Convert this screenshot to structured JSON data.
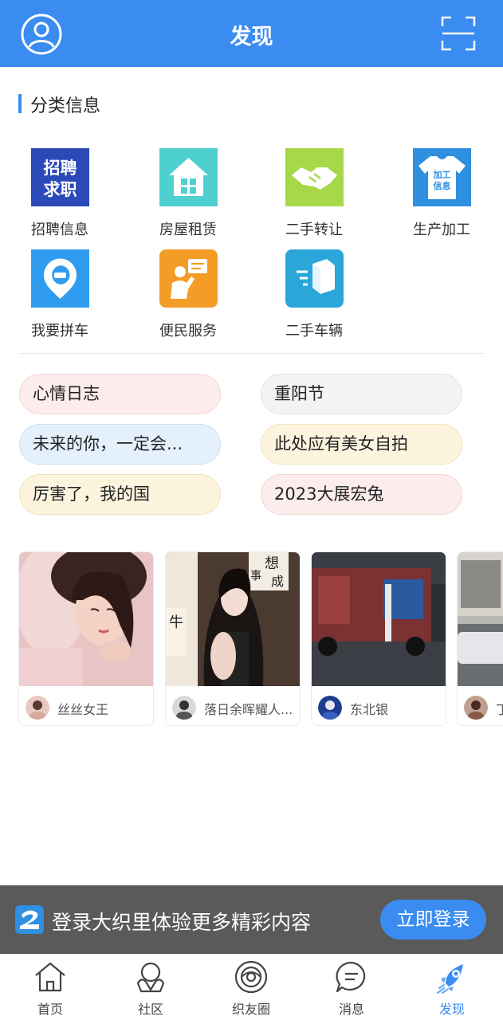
{
  "header": {
    "title": "发现",
    "avatar_icon": "user-avatar-icon",
    "scan_icon": "scan-icon",
    "background": "#3a8cf0"
  },
  "category_section": {
    "title": "分类信息",
    "items": [
      {
        "label": "招聘信息",
        "icon": "job-recruit-icon",
        "icon_text": [
          "招聘",
          "求职"
        ],
        "color": "#2b4ab8"
      },
      {
        "label": "房屋租赁",
        "icon": "house-icon",
        "color": "#4fd0d0"
      },
      {
        "label": "二手转让",
        "icon": "handshake-icon",
        "color": "#a6d84a"
      },
      {
        "label": "生产加工",
        "icon": "tshirt-icon",
        "icon_text": [
          "加工",
          "信息"
        ],
        "color": "#2f8fe0"
      },
      {
        "label": "我要拼车",
        "icon": "carpool-icon",
        "color": "#2f9cf0"
      },
      {
        "label": "便民服务",
        "icon": "service-icon",
        "color": "#f39c26"
      },
      {
        "label": "二手车辆",
        "icon": "delivery-box-icon",
        "color": "#2aa6d8"
      }
    ]
  },
  "topics": [
    {
      "label": "心情日志",
      "style": "pink"
    },
    {
      "label": "重阳节",
      "style": "gray"
    },
    {
      "label": "未来的你，一定会...",
      "style": "blue"
    },
    {
      "label": "此处应有美女自拍",
      "style": "yellow"
    },
    {
      "label": "厉害了，我的国",
      "style": "yellow"
    },
    {
      "label": "2023大展宏兔",
      "style": "pink"
    }
  ],
  "posts": [
    {
      "author": "丝丝女王",
      "photo": "girl-in-pink-coat-photo"
    },
    {
      "author": "落日余晖耀人...",
      "photo": "girl-with-calligraphy-photo",
      "photo_text": [
        "想",
        "成",
        "事",
        "牛"
      ]
    },
    {
      "author": "东北银",
      "photo": "red-truck-street-photo"
    },
    {
      "author": "丁",
      "photo": "street-cars-photo"
    }
  ],
  "login_banner": {
    "message": "登录大织里体验更多精彩内容",
    "button": "立即登录",
    "logo_icon": "app-logo-icon"
  },
  "tabbar": [
    {
      "label": "首页",
      "icon": "home-icon",
      "active": false
    },
    {
      "label": "社区",
      "icon": "community-icon",
      "active": false
    },
    {
      "label": "织友圈",
      "icon": "friend-circle-icon",
      "active": false
    },
    {
      "label": "消息",
      "icon": "message-icon",
      "active": false
    },
    {
      "label": "发现",
      "icon": "rocket-icon",
      "active": true
    }
  ],
  "colors": {
    "accent": "#3a8cf0",
    "banner": "#5a5a5a"
  }
}
